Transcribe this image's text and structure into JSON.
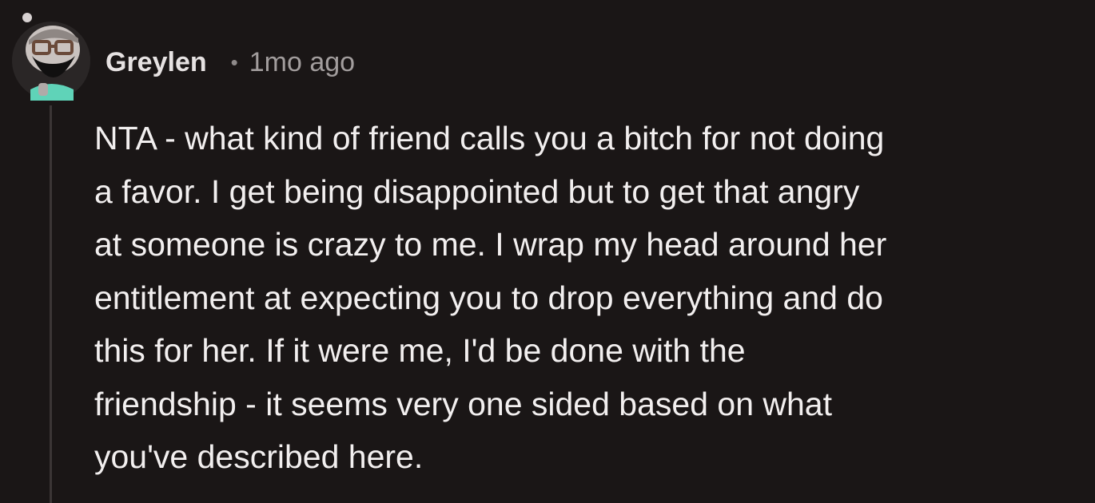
{
  "comment": {
    "author": "Greylen",
    "separator": "•",
    "timestamp": "1mo ago",
    "avatar_icon": "bearded-glasses-avatar-icon",
    "lines": [
      "NTA - what kind of friend calls you a bitch for not doing",
      "a favor. I get being disappointed but to get that angry",
      "at someone is crazy to me. I wrap my head around her",
      "entitlement at expecting you to drop everything and do",
      "this for her. If it were me, I'd be done with the",
      "friendship - it seems very one sided based on what",
      "you've described here."
    ]
  },
  "colors": {
    "background": "#1a1616",
    "text": "#f2efef",
    "muted": "#a29d9d",
    "thread_line": "#3b3535",
    "avatar_bg": "#2a2626",
    "avatar_shirt": "#5fd3b8"
  }
}
